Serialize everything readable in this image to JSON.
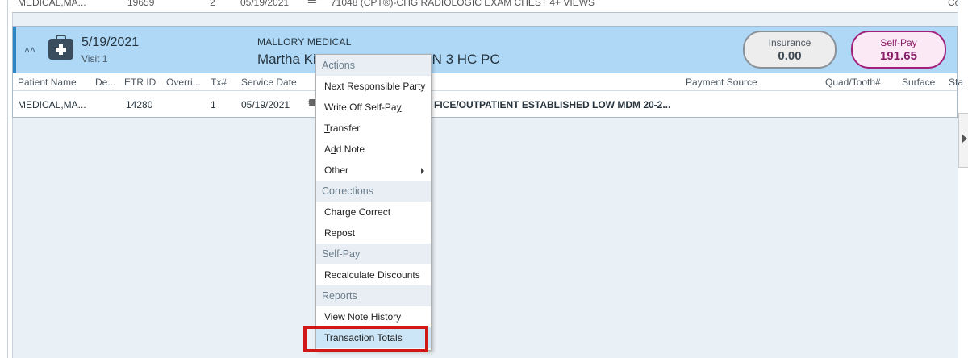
{
  "prev_row": {
    "patient": "MEDICAL,MA...",
    "etr_id": "19659",
    "tx": "2",
    "service_date": "05/19/2021",
    "description": "71048 (CPT®)-CHG RADIOLOGIC EXAM CHEST 4+ VIEWS",
    "edge_text": "Co"
  },
  "visit": {
    "date": "5/19/2021",
    "visit_label": "Visit 1",
    "facility": "MALLORY MEDICAL",
    "provider_start": "Martha Ki",
    "provider_end": "RSON 3 HC PC",
    "insurance": {
      "label": "Insurance",
      "amount": "0.00"
    },
    "self_pay": {
      "label": "Self-Pay",
      "amount": "191.65"
    },
    "accent_color": "#2b86c8",
    "self_pay_color": "#a1207a"
  },
  "columns": {
    "patient_name": "Patient Name",
    "de": "De...",
    "etr_id": "ETR ID",
    "override": "Overri...",
    "tx": "Tx#",
    "service_date": "Service Date",
    "payment_source": "Payment Source",
    "quad_tooth": "Quad/Tooth#",
    "surface": "Surface",
    "status": "Sta"
  },
  "row": {
    "patient": "MEDICAL,MA...",
    "etr_id": "14280",
    "tx": "1",
    "service_date": "05/19/2021",
    "description": "FICE/OUTPATIENT ESTABLISHED LOW MDM 20-2..."
  },
  "menu": {
    "sec_actions": "Actions",
    "next_party": "Next Responsible Party",
    "write_off_a": "Write Off Self-Pa",
    "write_off_u": "y",
    "transfer_u": "T",
    "transfer_b": "ransfer",
    "add_note_a": "A",
    "add_note_u": "d",
    "add_note_b": "d Note",
    "other": "Other",
    "sec_corrections": "Corrections",
    "charge_correct": "Charge Correct",
    "repost": "Repost",
    "sec_selfpay": "Self-Pay",
    "recalc": "Recalculate Discounts",
    "sec_reports": "Reports",
    "note_history": "View Note History",
    "transaction_totals": "Transaction Totals"
  },
  "highlight_color": "#d01818"
}
